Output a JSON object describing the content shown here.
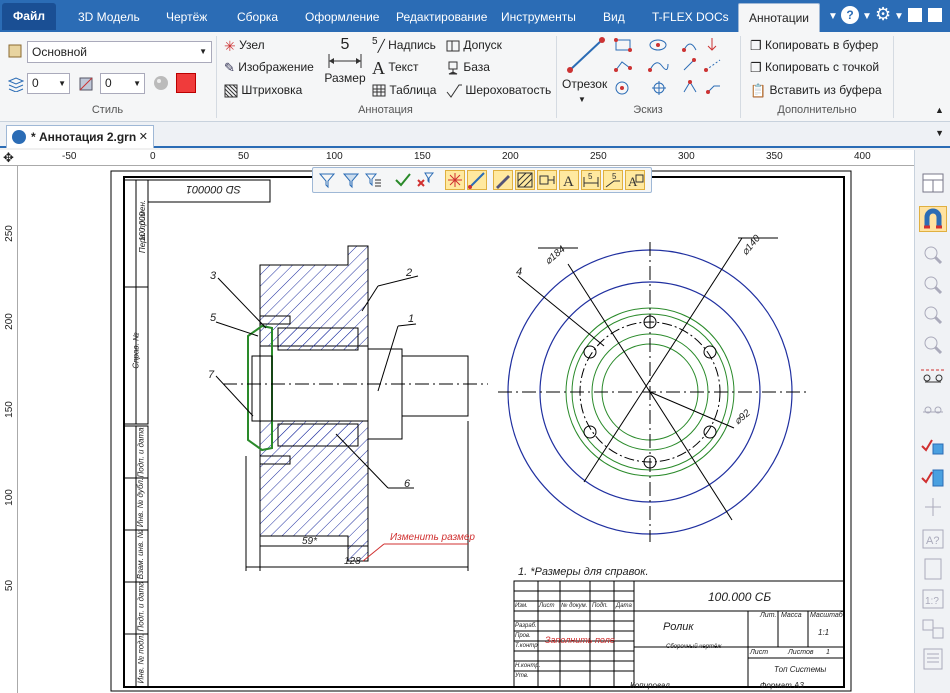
{
  "tabs": {
    "file": "Файл",
    "items": [
      "3D Модель",
      "Чертёж",
      "Сборка",
      "Оформление",
      "Редактирование",
      "Инструменты",
      "Вид",
      "T-FLEX DOCs",
      "Аннотации"
    ]
  },
  "ribbon": {
    "style": {
      "label": "Стиль",
      "preset": "Основной",
      "layer_value": "0",
      "level_value": "0"
    },
    "annotation": {
      "label": "Аннотация",
      "node": "Узел",
      "image": "Изображение",
      "hatch": "Штриховка",
      "size_value": "5",
      "size": "Размер",
      "inscription_num": "5",
      "inscription": "Надпись",
      "text": "Текст",
      "table": "Таблица",
      "tolerance": "Допуск",
      "base": "База",
      "roughness": "Шероховатость"
    },
    "sketch": {
      "label": "Эскиз",
      "segment": "Отрезок"
    },
    "extra": {
      "label": "Дополнительно",
      "copy": "Копировать в буфер",
      "copy_point": "Копировать с точкой",
      "paste": "Вставить из буфера"
    }
  },
  "document": {
    "tab_title": "* Аннотация 2.grn"
  },
  "ruler": {
    "h_labels": [
      "-50",
      "0",
      "50",
      "100",
      "150",
      "200",
      "250",
      "300",
      "350",
      "400"
    ],
    "v_labels": [
      "250",
      "200",
      "150",
      "100",
      "50"
    ]
  },
  "drawing": {
    "stamp_top": "SD 000001",
    "callouts": [
      "3",
      "2",
      "5",
      "1",
      "7",
      "6",
      "4"
    ],
    "dim_59": "59*",
    "dim_128": "128",
    "change_note": "Изменить размер",
    "dia_184": "⌀184",
    "dia_140": "⌀140",
    "dia_92": "⌀92",
    "note": "1. *Размеры для справок.",
    "title_code": "100.000 СБ",
    "part_name": "Ролик",
    "doc_type": "Сборочный чертёж",
    "fill_field": "Заполнить поле",
    "sheet_info": [
      "Лит.",
      "Масса",
      "Масштаб"
    ],
    "scale_value": "1:1",
    "sheet": "Лист",
    "sheets": "Листов",
    "sheets_count": "1",
    "org": "Топ Системы",
    "copied": "Копировал",
    "format": "Формат А3",
    "left_stamp": [
      "Перв. примен.",
      "Справ. №",
      "Подп. и дата",
      "Инв. № дубл.",
      "Взам. инв. №",
      "Подп. и дата",
      "Инв. № подл."
    ],
    "left_code": "100.000",
    "tb_rows": [
      "Изм.",
      "Лист",
      "№ докум.",
      "Подп.",
      "Дата"
    ],
    "tb_left": [
      "Разраб.",
      "Пров.",
      "Т.контр.",
      "Н.контр.",
      "Утв."
    ]
  },
  "colors": {
    "accent": "#2b6cb5",
    "note_red": "#d03030",
    "hatch": "#2030a0",
    "green": "#2a8a2a"
  }
}
